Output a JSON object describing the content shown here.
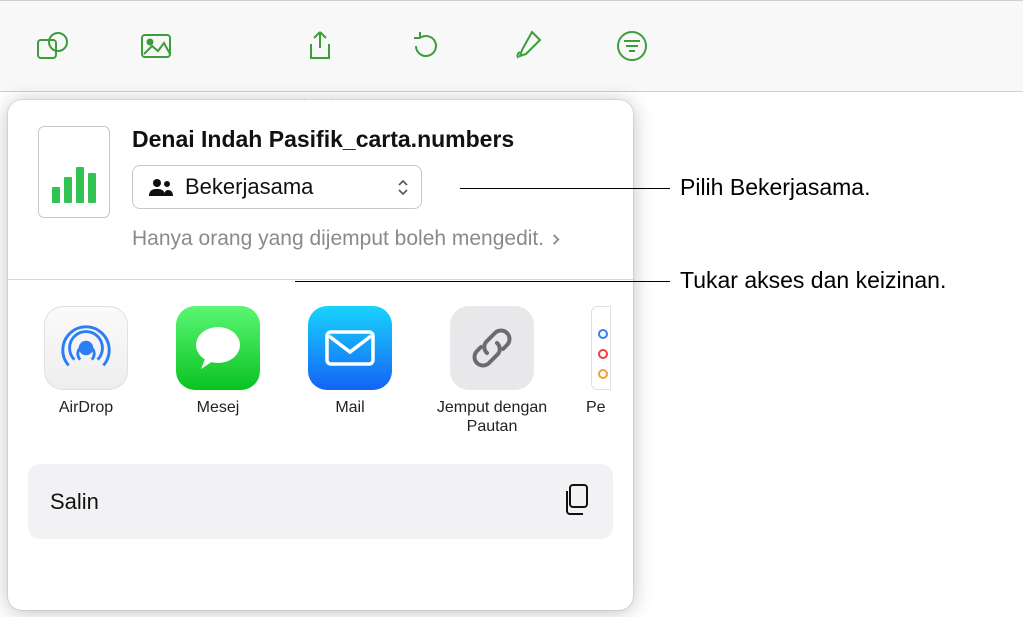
{
  "toolbar": {
    "icons": [
      "shapes-icon",
      "media-icon",
      "share-icon",
      "undo-icon",
      "format-brush-icon",
      "filter-icon"
    ]
  },
  "document": {
    "title": "Denai Indah Pasifik_carta.numbers"
  },
  "collaborate": {
    "label": "Bekerjasama",
    "permission_text": "Hanya orang yang dijemput boleh mengedit."
  },
  "apps": [
    {
      "name": "airdrop",
      "label": "AirDrop"
    },
    {
      "name": "messages",
      "label": "Mesej"
    },
    {
      "name": "mail",
      "label": "Mail"
    },
    {
      "name": "invite-link",
      "label": "Jemput dengan Pautan"
    },
    {
      "name": "reminders",
      "label_partial": "Pe"
    }
  ],
  "actions": {
    "copy_label": "Salin"
  },
  "callouts": {
    "collaborate": "Pilih Bekerjasama.",
    "permission": "Tukar akses dan keizinan."
  }
}
